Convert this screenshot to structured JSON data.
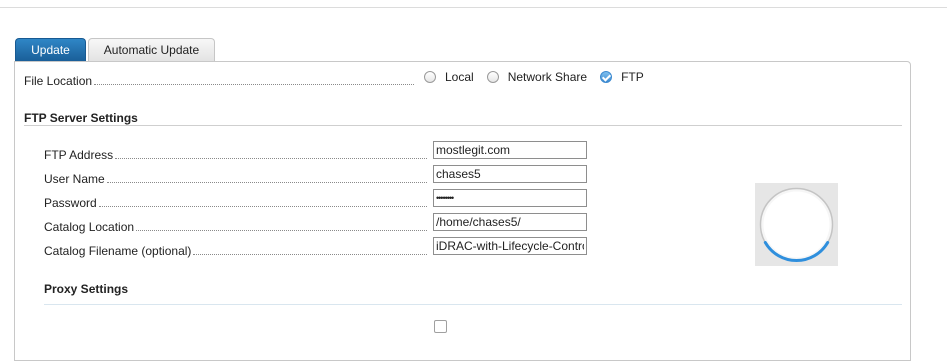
{
  "tabs": [
    {
      "label": "Update",
      "active": true
    },
    {
      "label": "Automatic Update",
      "active": false
    }
  ],
  "file_location": {
    "label": "File Location",
    "options": [
      {
        "label": "Local",
        "selected": false
      },
      {
        "label": "Network Share",
        "selected": false
      },
      {
        "label": "FTP",
        "selected": true
      }
    ]
  },
  "ftp_settings": {
    "title": "FTP Server Settings",
    "fields": [
      {
        "label": "FTP Address",
        "value": "mostlegit.com"
      },
      {
        "label": "User Name",
        "value": "chases5"
      },
      {
        "label": "Password",
        "value": "••••••••"
      },
      {
        "label": "Catalog Location",
        "value": "/home/chases5/"
      },
      {
        "label": "Catalog Filename (optional)",
        "value": "iDRAC-with-Lifecycle-Controller"
      }
    ]
  },
  "proxy_settings": {
    "title": "Proxy Settings"
  },
  "loading_indicator": {
    "icon": "spinner-icon"
  },
  "colors": {
    "tab_active": "#1f6fb0",
    "radio_checked": "#3d8ad0",
    "spinner_arc": "#2f8fdd"
  }
}
